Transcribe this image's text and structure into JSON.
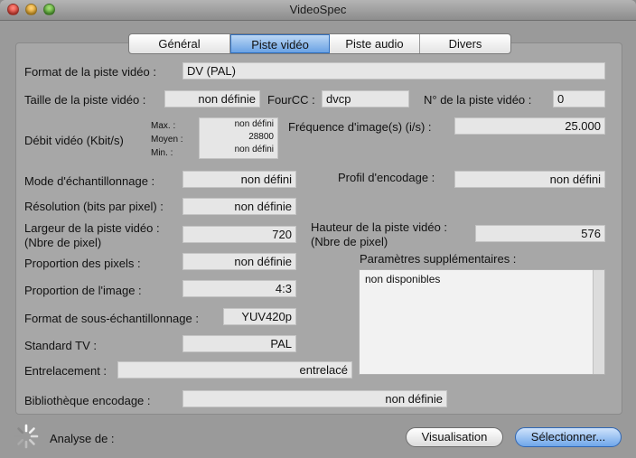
{
  "window": {
    "title": "VideoSpec"
  },
  "tabs": [
    {
      "label": "Général",
      "active": false
    },
    {
      "label": "Piste vidéo",
      "active": true
    },
    {
      "label": "Piste audio",
      "active": false
    },
    {
      "label": "Divers",
      "active": false
    }
  ],
  "fields": {
    "format_label": "Format de la piste vidéo :",
    "format_value": "DV (PAL)",
    "taille_label": "Taille de la piste vidéo :",
    "taille_value": "non définie",
    "fourcc_label": "FourCC :",
    "fourcc_value": "dvcp",
    "numero_label": "N° de la piste vidéo :",
    "numero_value": "0",
    "debit_label": "Débit vidéo (Kbit/s)",
    "debit_max_label": "Max. :",
    "debit_moyen_label": "Moyen :",
    "debit_min_label": "Min. :",
    "debit_max_value": "non défini",
    "debit_moyen_value": "28800",
    "debit_min_value": "non défini",
    "frequence_label": "Fréquence d'image(s) (i/s) :",
    "frequence_value": "25.000",
    "mode_label": "Mode d'échantillonnage :",
    "mode_value": "non défini",
    "profil_label": "Profil d'encodage :",
    "profil_value": "non défini",
    "resolution_label": "Résolution (bits par pixel) :",
    "resolution_value": "non définie",
    "largeur_label_1": "Largeur de la piste vidéo :",
    "largeur_label_2": "(Nbre de pixel)",
    "largeur_value": "720",
    "hauteur_label_1": "Hauteur de la piste vidéo :",
    "hauteur_label_2": "(Nbre de pixel)",
    "hauteur_value": "576",
    "prop_pixels_label": "Proportion des pixels :",
    "prop_pixels_value": "non définie",
    "params_label": "Paramètres supplémentaires :",
    "params_value": "non disponibles",
    "prop_image_label": "Proportion de l'image :",
    "prop_image_value": "4:3",
    "sous_ech_label": "Format de sous-échantillonnage :",
    "sous_ech_value": "YUV420p",
    "standard_label": "Standard TV :",
    "standard_value": "PAL",
    "entrelacement_label": "Entrelacement :",
    "entrelacement_value": "entrelacé",
    "bibliotheque_label": "Bibliothèque encodage :",
    "bibliotheque_value": "non définie"
  },
  "footer": {
    "analyse_label": "Analyse de :",
    "visualisation_button": "Visualisation",
    "selectionner_button": "Sélectionner..."
  }
}
